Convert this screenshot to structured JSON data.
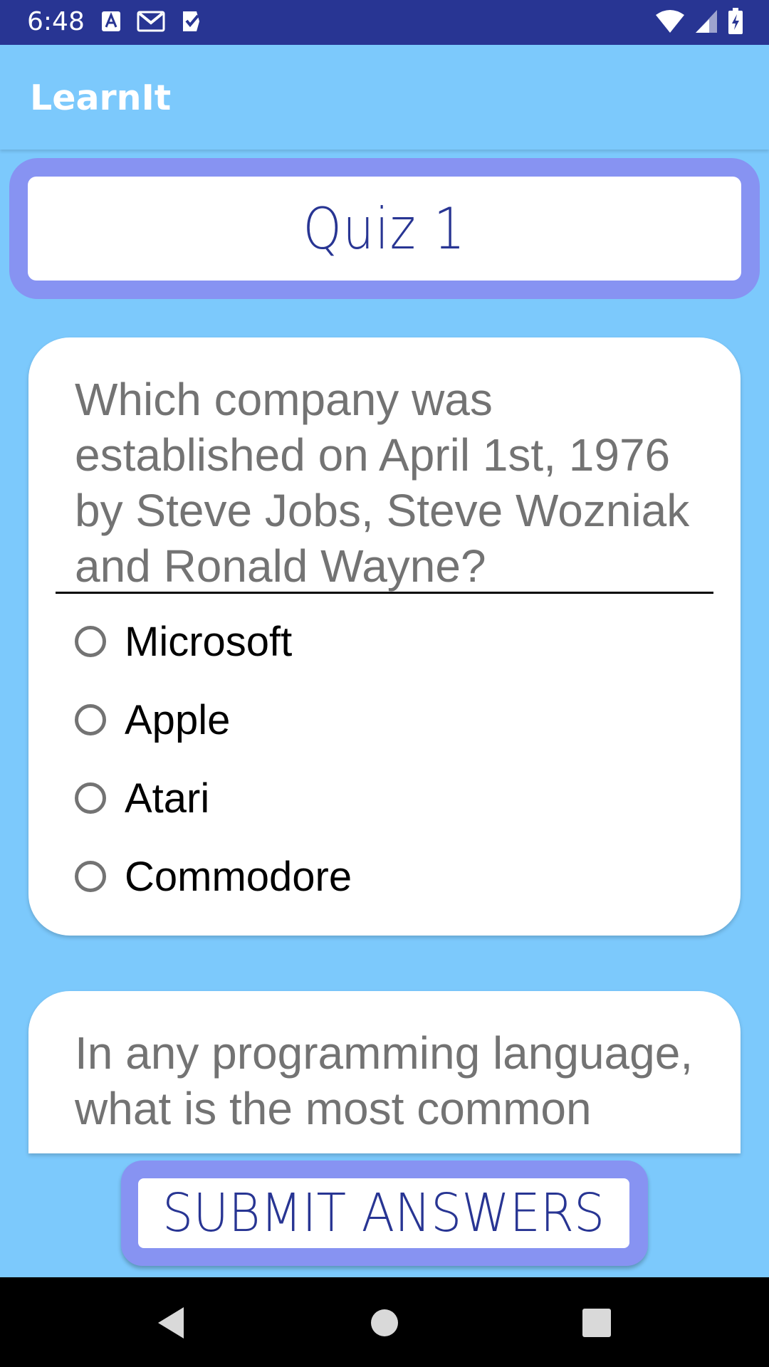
{
  "status_bar": {
    "time": "6:48",
    "icons": [
      "font-icon",
      "gmail-icon",
      "tasks-icon",
      "wifi-icon",
      "signal-icon",
      "battery-icon"
    ],
    "background": "#283593"
  },
  "app_bar": {
    "title": "LearnIt",
    "background": "#7cc9fc"
  },
  "quiz": {
    "title": "Quiz 1",
    "accent": "#283593",
    "frame_color": "#8793f2"
  },
  "questions": [
    {
      "text": "Which company was established on April 1st, 1976 by Steve Jobs, Steve Wozniak and Ronald Wayne?",
      "options": [
        "Microsoft",
        "Apple",
        "Atari",
        "Commodore"
      ]
    },
    {
      "text": "In any programming language, what is the most common"
    }
  ],
  "submit": {
    "label": "SUBMIT ANSWERS"
  },
  "nav_bar": {
    "icons": [
      "back-icon",
      "home-icon",
      "recents-icon"
    ]
  }
}
